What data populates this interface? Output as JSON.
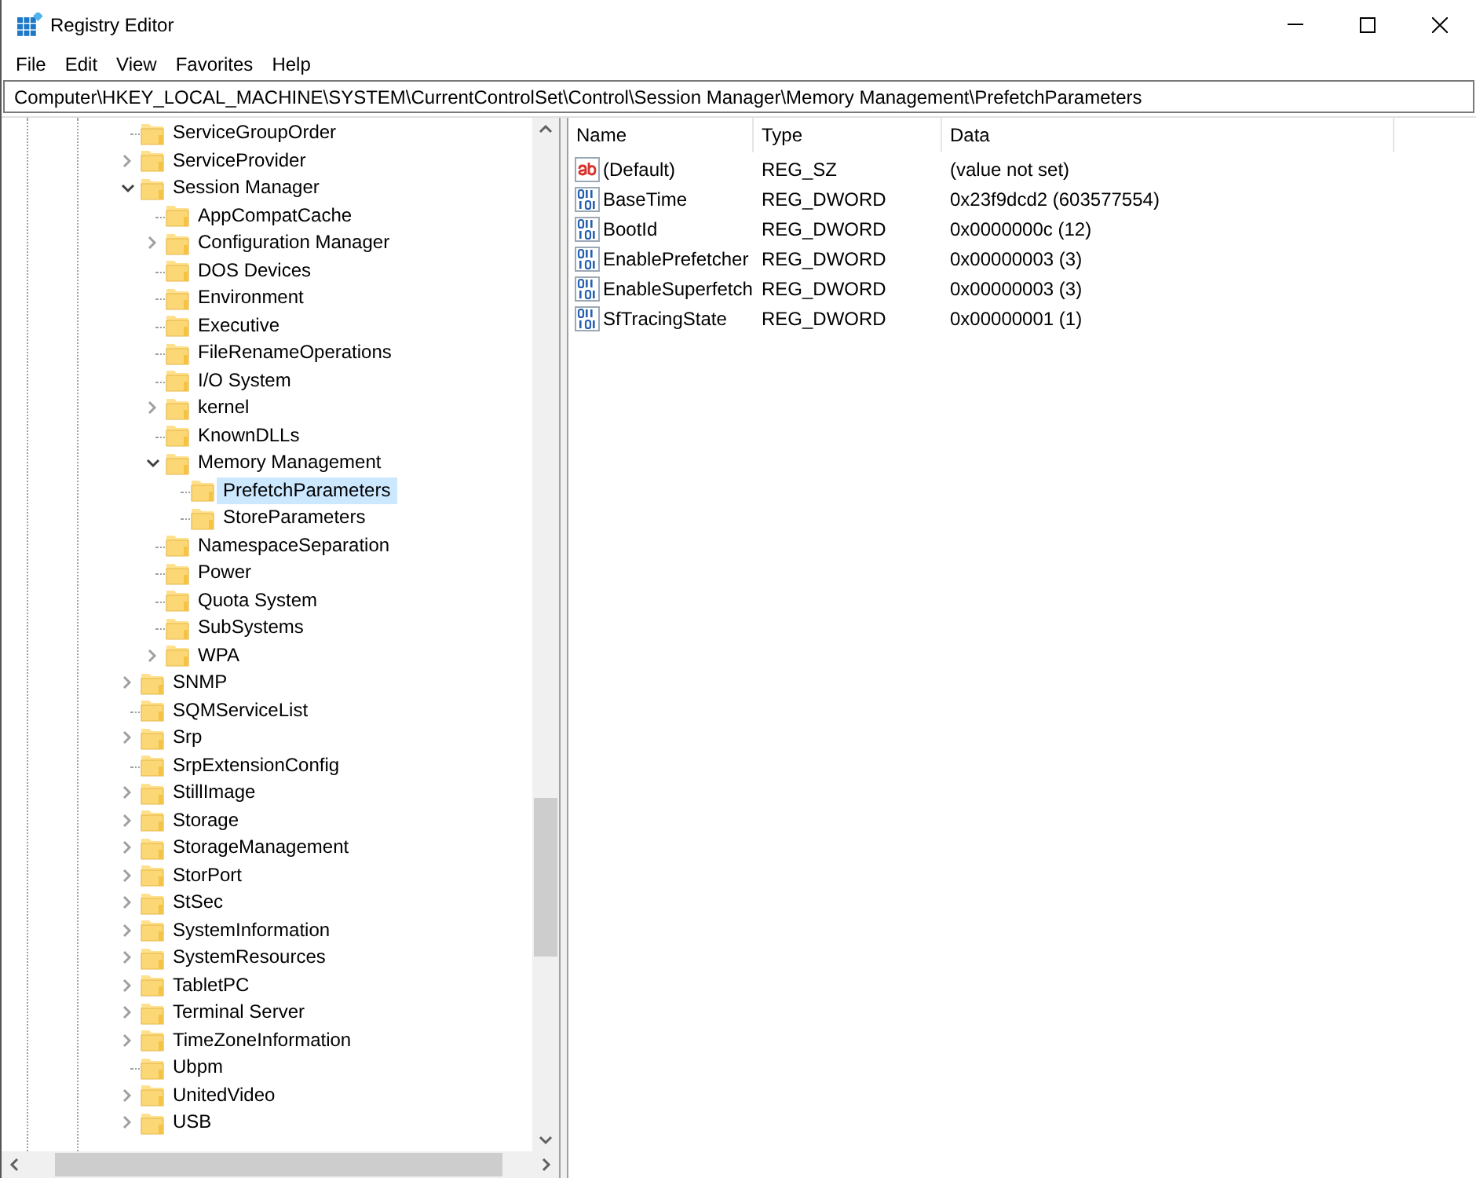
{
  "window": {
    "title": "Registry Editor"
  },
  "menu": [
    "File",
    "Edit",
    "View",
    "Favorites",
    "Help"
  ],
  "address": "Computer\\HKEY_LOCAL_MACHINE\\SYSTEM\\CurrentControlSet\\Control\\Session Manager\\Memory Management\\PrefetchParameters",
  "tree": [
    {
      "label": "ServiceGroupOrder",
      "kind": "leaf",
      "selected": false
    },
    {
      "label": "ServiceProvider",
      "kind": "node",
      "expanded": false,
      "selected": false
    },
    {
      "label": "Session Manager",
      "kind": "node",
      "expanded": true,
      "selected": false,
      "children": [
        {
          "label": "AppCompatCache",
          "kind": "leaf",
          "selected": false
        },
        {
          "label": "Configuration Manager",
          "kind": "node",
          "expanded": false,
          "selected": false
        },
        {
          "label": "DOS Devices",
          "kind": "leaf",
          "selected": false
        },
        {
          "label": "Environment",
          "kind": "leaf",
          "selected": false
        },
        {
          "label": "Executive",
          "kind": "leaf",
          "selected": false
        },
        {
          "label": "FileRenameOperations",
          "kind": "leaf",
          "selected": false
        },
        {
          "label": "I/O System",
          "kind": "leaf",
          "selected": false
        },
        {
          "label": "kernel",
          "kind": "node",
          "expanded": false,
          "selected": false
        },
        {
          "label": "KnownDLLs",
          "kind": "leaf",
          "selected": false
        },
        {
          "label": "Memory Management",
          "kind": "node",
          "expanded": true,
          "selected": false,
          "children": [
            {
              "label": "PrefetchParameters",
              "kind": "leaf",
              "selected": true
            },
            {
              "label": "StoreParameters",
              "kind": "leaf",
              "selected": false
            }
          ]
        },
        {
          "label": "NamespaceSeparation",
          "kind": "leaf",
          "selected": false
        },
        {
          "label": "Power",
          "kind": "leaf",
          "selected": false
        },
        {
          "label": "Quota System",
          "kind": "leaf",
          "selected": false
        },
        {
          "label": "SubSystems",
          "kind": "leaf",
          "selected": false
        },
        {
          "label": "WPA",
          "kind": "node",
          "expanded": false,
          "selected": false
        }
      ]
    },
    {
      "label": "SNMP",
      "kind": "node",
      "expanded": false,
      "selected": false
    },
    {
      "label": "SQMServiceList",
      "kind": "leaf",
      "selected": false
    },
    {
      "label": "Srp",
      "kind": "node",
      "expanded": false,
      "selected": false
    },
    {
      "label": "SrpExtensionConfig",
      "kind": "leaf",
      "selected": false
    },
    {
      "label": "StillImage",
      "kind": "node",
      "expanded": false,
      "selected": false
    },
    {
      "label": "Storage",
      "kind": "node",
      "expanded": false,
      "selected": false
    },
    {
      "label": "StorageManagement",
      "kind": "node",
      "expanded": false,
      "selected": false
    },
    {
      "label": "StorPort",
      "kind": "node",
      "expanded": false,
      "selected": false
    },
    {
      "label": "StSec",
      "kind": "node",
      "expanded": false,
      "selected": false
    },
    {
      "label": "SystemInformation",
      "kind": "node",
      "expanded": false,
      "selected": false
    },
    {
      "label": "SystemResources",
      "kind": "node",
      "expanded": false,
      "selected": false
    },
    {
      "label": "TabletPC",
      "kind": "node",
      "expanded": false,
      "selected": false
    },
    {
      "label": "Terminal Server",
      "kind": "node",
      "expanded": false,
      "selected": false
    },
    {
      "label": "TimeZoneInformation",
      "kind": "node",
      "expanded": false,
      "selected": false
    },
    {
      "label": "Ubpm",
      "kind": "leaf",
      "selected": false
    },
    {
      "label": "UnitedVideo",
      "kind": "node",
      "expanded": false,
      "selected": false
    },
    {
      "label": "USB",
      "kind": "node",
      "expanded": false,
      "selected": false
    }
  ],
  "values": {
    "columns": [
      "Name",
      "Type",
      "Data"
    ],
    "rows": [
      {
        "kind": "string",
        "name": "(Default)",
        "type": "REG_SZ",
        "data": "(value not set)"
      },
      {
        "kind": "binary",
        "name": "BaseTime",
        "type": "REG_DWORD",
        "data": "0x23f9dcd2 (603577554)"
      },
      {
        "kind": "binary",
        "name": "BootId",
        "type": "REG_DWORD",
        "data": "0x0000000c (12)"
      },
      {
        "kind": "binary",
        "name": "EnablePrefetcher",
        "type": "REG_DWORD",
        "data": "0x00000003 (3)"
      },
      {
        "kind": "binary",
        "name": "EnableSuperfetch",
        "type": "REG_DWORD",
        "data": "0x00000003 (3)"
      },
      {
        "kind": "binary",
        "name": "SfTracingState",
        "type": "REG_DWORD",
        "data": "0x00000001 (1)"
      }
    ]
  }
}
